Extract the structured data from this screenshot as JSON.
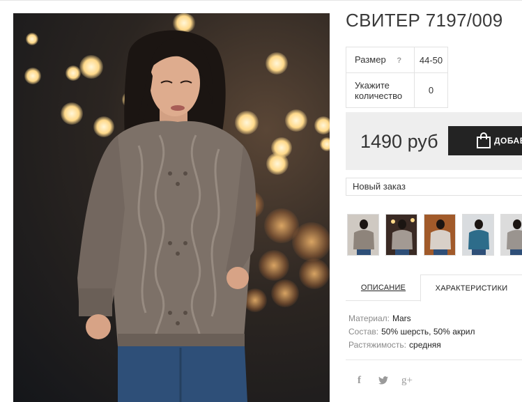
{
  "product": {
    "title": "СВИТЕР 7197/009",
    "image_alt": "Вязаный свитер серо-бежевого цвета на модели"
  },
  "spec_table": [
    {
      "label": "Размер",
      "help": "?",
      "value": "44-50"
    },
    {
      "label": "Укажите количество",
      "value": "0"
    }
  ],
  "purchase": {
    "price": "1490 руб",
    "buy_label": "ДОБАВИТЬ",
    "order_select": "Новый заказ"
  },
  "thumbnails": [
    {
      "name": "thumb-1",
      "bg": "#cfc9c2",
      "sweater": "#8e847b"
    },
    {
      "name": "thumb-2",
      "bg": "#3a2a24",
      "sweater": "#a39a93"
    },
    {
      "name": "thumb-3",
      "bg": "#a15a2a",
      "sweater": "#d8d0c8"
    },
    {
      "name": "thumb-4",
      "bg": "#d9dcdf",
      "sweater": "#2d6c8a"
    },
    {
      "name": "thumb-5",
      "bg": "#dcdcdc",
      "sweater": "#9a948f"
    }
  ],
  "tabs": {
    "description": "ОПИСАНИЕ",
    "characteristics": "ХАРАКТЕРИСТИКИ"
  },
  "characteristics": [
    {
      "key": "Материал:",
      "value": "Mars"
    },
    {
      "key": "Состав:",
      "value": "50% шерсть, 50% акрил"
    },
    {
      "key": "Растяжимость:",
      "value": "средняя"
    }
  ],
  "social": {
    "facebook": "f",
    "twitter": "twitter-icon",
    "google_plus": "g+"
  },
  "colors": {
    "button_bg": "#232323",
    "price_bg": "#eeeeee",
    "sweater": "#7d7168"
  }
}
